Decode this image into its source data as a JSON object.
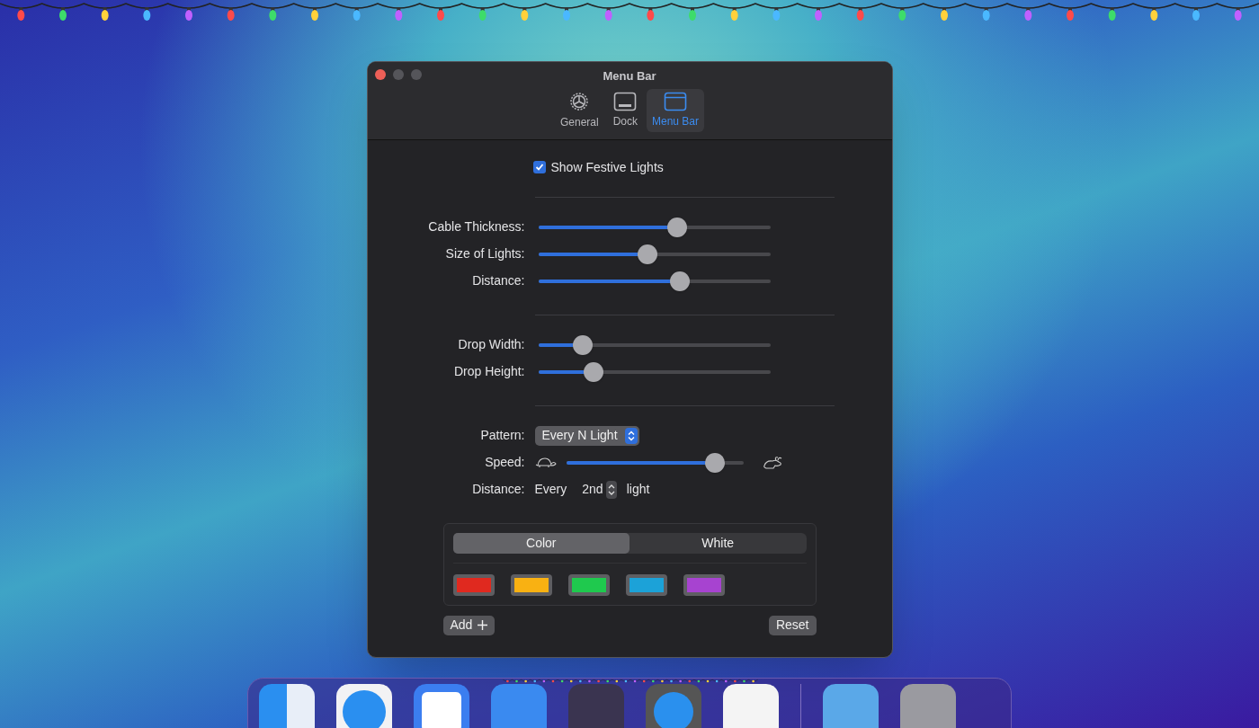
{
  "window": {
    "title": "Menu Bar"
  },
  "tabs": [
    {
      "label": "General",
      "kind": "gear",
      "selected": false
    },
    {
      "label": "Dock",
      "kind": "dock",
      "selected": false
    },
    {
      "label": "Menu Bar",
      "kind": "menubar",
      "selected": true
    }
  ],
  "show_lights": {
    "label": "Show Festive Lights",
    "checked": true
  },
  "slider_groups": [
    [
      {
        "label": "Cable Thickness:",
        "level": 0.6
      },
      {
        "label": "Size of Lights:",
        "level": 0.47
      },
      {
        "label": "Distance:",
        "level": 0.61
      }
    ],
    [
      {
        "label": "Drop Width:",
        "level": 0.19
      },
      {
        "label": "Drop Height:",
        "level": 0.24
      }
    ]
  ],
  "pattern": {
    "label": "Pattern:",
    "value": "Every N Light"
  },
  "speed": {
    "label": "Speed:",
    "level": 0.84
  },
  "distance": {
    "label": "Distance:",
    "prefix": "Every",
    "value": "2nd",
    "suffix": "light"
  },
  "segments": [
    {
      "label": "Color",
      "selected": true
    },
    {
      "label": "White",
      "selected": false
    }
  ],
  "swatches": [
    {
      "color": "#e0291f"
    },
    {
      "color": "#f9b112"
    },
    {
      "color": "#1fc94e"
    },
    {
      "color": "#1ca2d8"
    },
    {
      "color": "#a743d0"
    }
  ],
  "buttons": {
    "add": "Add",
    "reset": "Reset"
  }
}
